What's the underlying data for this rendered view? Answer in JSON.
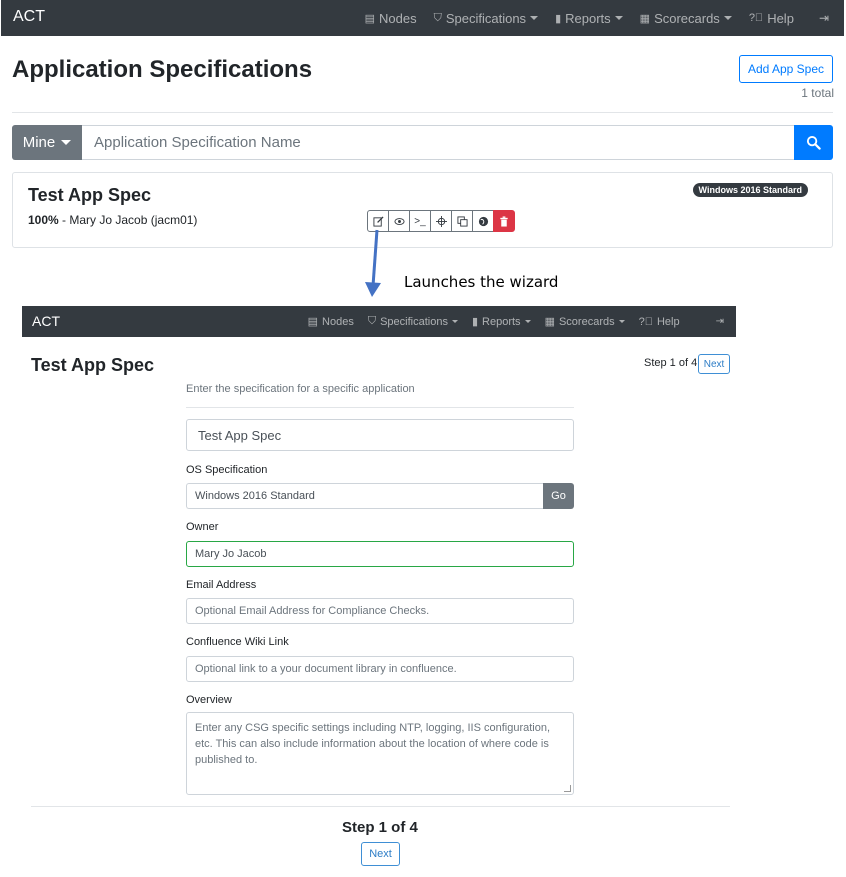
{
  "navbar": {
    "brand": "ACT",
    "items": [
      {
        "label": "Nodes",
        "icon": "table-icon"
      },
      {
        "label": "Specifications",
        "icon": "shield-icon"
      },
      {
        "label": "Reports",
        "icon": "file-icon"
      },
      {
        "label": "Scorecards",
        "icon": "table-icon"
      },
      {
        "label": "Help",
        "icon": "question-circle-icon"
      }
    ],
    "logout_icon": "sign-out-icon"
  },
  "header": {
    "title": "Application Specifications",
    "add_button": "Add App Spec",
    "total": "1 total"
  },
  "search": {
    "filter_label": "Mine",
    "placeholder": "Application Specification Name",
    "button_icon": "search-icon"
  },
  "card": {
    "title": "Test App Spec",
    "percent": "100%",
    "owner": " - Mary Jo Jacob (jacm01)",
    "os_badge": "Windows 2016 Standard",
    "actions": [
      "edit-icon",
      "eye-icon",
      "terminal-icon",
      "crosshairs-icon",
      "copy-icon",
      "globe-icon",
      "trash-icon"
    ],
    "danger_color": "#dc3545"
  },
  "annotation": {
    "text": "Launches the wizard",
    "arrow_color": "#4472c4"
  },
  "wizard": {
    "navbar": {
      "brand": "ACT",
      "items": [
        "Nodes",
        "Specifications",
        "Reports",
        "Scorecards",
        "Help"
      ]
    },
    "title": "Test App Spec",
    "step_text": "Step 1 of 4",
    "next_label": "Next",
    "description": "Enter the specification for a specific application",
    "name_value": "Test App Spec",
    "os_label": "OS Specification",
    "os_value": "Windows 2016 Standard",
    "go_label": "Go",
    "owner_label": "Owner",
    "owner_value": "Mary Jo Jacob",
    "email_label": "Email Address",
    "email_placeholder": "Optional Email Address for Compliance Checks.",
    "wiki_label": "Confluence Wiki Link",
    "wiki_placeholder": "Optional link to a your document library in confluence.",
    "overview_label": "Overview",
    "overview_placeholder": "Enter any CSG specific settings including NTP, logging, IIS configuration, etc. This can also include information about the location of where code is published to.",
    "bottom_step_text": "Step 1 of 4",
    "bottom_next_label": "Next"
  },
  "colors": {
    "navbar_bg": "#343a40",
    "primary": "#007bff",
    "secondary": "#6c757d",
    "success": "#28a745"
  }
}
